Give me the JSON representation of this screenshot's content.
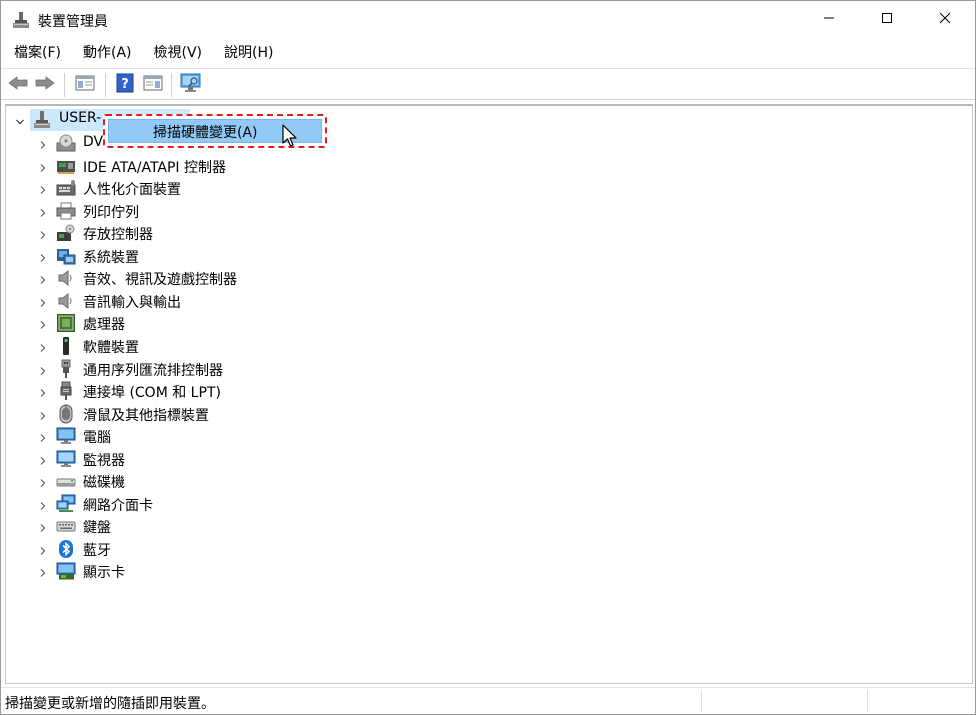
{
  "window": {
    "title": "裝置管理員",
    "icons": {
      "title": "device-manager-icon",
      "minimize": "minimize-icon",
      "maximize": "maximize-icon",
      "close": "close-icon"
    }
  },
  "menu": [
    "檔案(F)",
    "動作(A)",
    "檢視(V)",
    "說明(H)"
  ],
  "toolbar": {
    "icons": [
      "back-arrow-icon",
      "forward-arrow-icon",
      "properties-pane-icon",
      "help-icon",
      "action-pane-icon",
      "scan-monitor-icon"
    ]
  },
  "tree": {
    "root": {
      "label": "USER-",
      "icon": "computer-tower-icon"
    },
    "items": [
      {
        "label": "DV",
        "icon": "dvd-drive-icon"
      },
      {
        "label": "IDE ATA/ATAPI 控制器",
        "icon": "ide-controller-icon"
      },
      {
        "label": "人性化介面裝置",
        "icon": "hid-icon"
      },
      {
        "label": "列印佇列",
        "icon": "printer-icon"
      },
      {
        "label": "存放控制器",
        "icon": "storage-controller-icon"
      },
      {
        "label": "系統裝置",
        "icon": "system-device-icon"
      },
      {
        "label": "音效、視訊及遊戲控制器",
        "icon": "speaker-icon"
      },
      {
        "label": "音訊輸入與輸出",
        "icon": "speaker-icon"
      },
      {
        "label": "處理器",
        "icon": "processor-icon"
      },
      {
        "label": "軟體裝置",
        "icon": "software-device-icon"
      },
      {
        "label": "通用序列匯流排控制器",
        "icon": "usb-icon"
      },
      {
        "label": "連接埠 (COM 和 LPT)",
        "icon": "port-icon"
      },
      {
        "label": "滑鼠及其他指標裝置",
        "icon": "mouse-icon"
      },
      {
        "label": "電腦",
        "icon": "computer-monitor-icon"
      },
      {
        "label": "監視器",
        "icon": "monitor-icon"
      },
      {
        "label": "磁碟機",
        "icon": "disk-drive-icon"
      },
      {
        "label": "網路介面卡",
        "icon": "network-adapter-icon"
      },
      {
        "label": "鍵盤",
        "icon": "keyboard-icon"
      },
      {
        "label": "藍牙",
        "icon": "bluetooth-icon"
      },
      {
        "label": "顯示卡",
        "icon": "display-adapter-icon"
      }
    ]
  },
  "context_menu": {
    "label": "掃描硬體變更(A)"
  },
  "status": {
    "text": "掃描變更或新增的隨插即用裝置。"
  }
}
